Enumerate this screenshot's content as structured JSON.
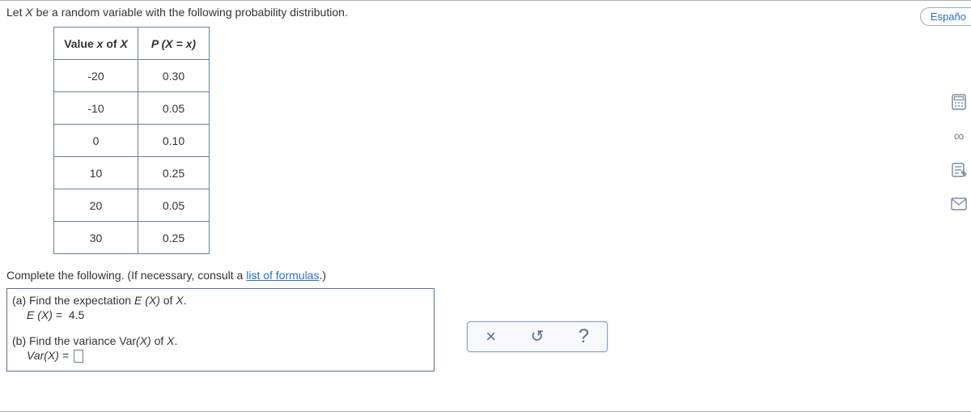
{
  "intro_prefix": "Let ",
  "intro_var": "X",
  "intro_suffix": " be a random variable with the following probability distribution.",
  "table": {
    "header_value_html": "Value x of X",
    "header_value_prefix": "Value ",
    "header_value_x": "x",
    "header_value_of": " of ",
    "header_value_X": "X",
    "header_px": "P (X = x)",
    "header_px_P": "P",
    "header_px_open": " (",
    "header_px_X": "X",
    "header_px_eq": " = ",
    "header_px_x": "x",
    "header_px_close": ")",
    "rows": [
      {
        "x": "-20",
        "p": "0.30"
      },
      {
        "x": "-10",
        "p": "0.05"
      },
      {
        "x": "0",
        "p": "0.10"
      },
      {
        "x": "10",
        "p": "0.25"
      },
      {
        "x": "20",
        "p": "0.05"
      },
      {
        "x": "30",
        "p": "0.25"
      }
    ]
  },
  "complete_prefix": "Complete the following. (If necessary, consult a ",
  "complete_link": "list of formulas",
  "complete_suffix": ".)",
  "parts": {
    "a_label": "(a) Find the expectation ",
    "a_expr": "E (X)",
    "a_of": " of ",
    "a_X": "X",
    "a_period": ".",
    "a_formula_lhs": "E (X) = ",
    "a_value": "4.5",
    "b_label": "(b) Find the variance Var",
    "b_expr": "(X)",
    "b_of": " of ",
    "b_X": "X",
    "b_period": ".",
    "b_formula_lhs": "Var(X) = "
  },
  "toolbox": {
    "clear": "×",
    "undo": "↺",
    "help": "?"
  },
  "lang_label": "Españo",
  "icons": {
    "calculator": "calculator-icon",
    "infinity": "infinity-icon",
    "notes": "notes-icon",
    "mail": "mail-icon"
  }
}
